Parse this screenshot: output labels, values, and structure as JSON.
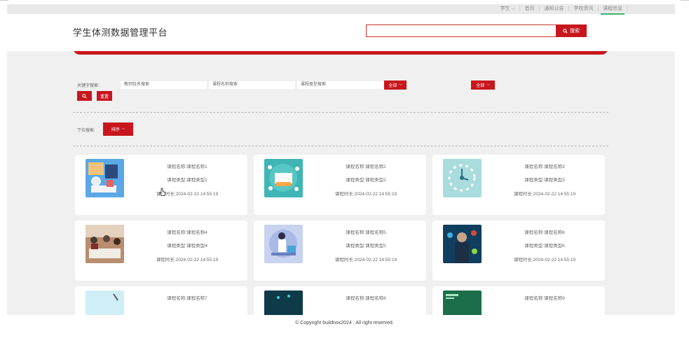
{
  "topnav": {
    "user": "学生",
    "links": [
      "首页",
      "通知公告",
      "学校资讯",
      "课程信息"
    ]
  },
  "header": {
    "title": "学生体测数据管理平台",
    "search_value": "",
    "search_button": "搜索"
  },
  "filters": {
    "keyword_label": "关键字搜索:",
    "teacher_placeholder": "教师姓名搜索",
    "course_name_placeholder": "课程名称搜索",
    "course_type_placeholder": "课程类型搜索",
    "select1": "全部",
    "select2": "全部",
    "reset_button": "重置"
  },
  "sort": {
    "label": "下拉搜索:",
    "select": "排序"
  },
  "cards": [
    {
      "name": "课程名称:课程名称1",
      "type": "课程类型:课程类型1",
      "duration": "课程时长:2024-02-22 14:55:19"
    },
    {
      "name": "课程名称:课程名称2",
      "type": "课程类型:课程类型2",
      "duration": "课程时长:2024-02-22 14:55:19"
    },
    {
      "name": "课程名称:课程名称3",
      "type": "课程类型:课程类型3",
      "duration": "课程时长:2024-02-22 14:55:19"
    },
    {
      "name": "课程名称:课程名称4",
      "type": "课程类型:课程类型4",
      "duration": "课程时长:2024-02-22 14:55:19"
    },
    {
      "name": "课程名称:课程名称5",
      "type": "课程类型:课程类型5",
      "duration": "课程时长:2024-02-22 14:55:19"
    },
    {
      "name": "课程名称:课程名称6",
      "type": "课程类型:课程类型6",
      "duration": "课程时长:2024-02-22 14:55:19"
    },
    {
      "name": "课程名称:课程名称7",
      "type": "",
      "duration": ""
    },
    {
      "name": "课程名称:课程名称8",
      "type": "",
      "duration": ""
    },
    {
      "name": "课程名称:课程名称9",
      "type": "",
      "duration": ""
    }
  ],
  "footer": {
    "copyright": "© Copyright buildnox2024 . All right reserved."
  },
  "colors": {
    "accent_red": "#c8161d",
    "active_underline": "#3cb371",
    "panel_bg": "#f0f0f0"
  }
}
